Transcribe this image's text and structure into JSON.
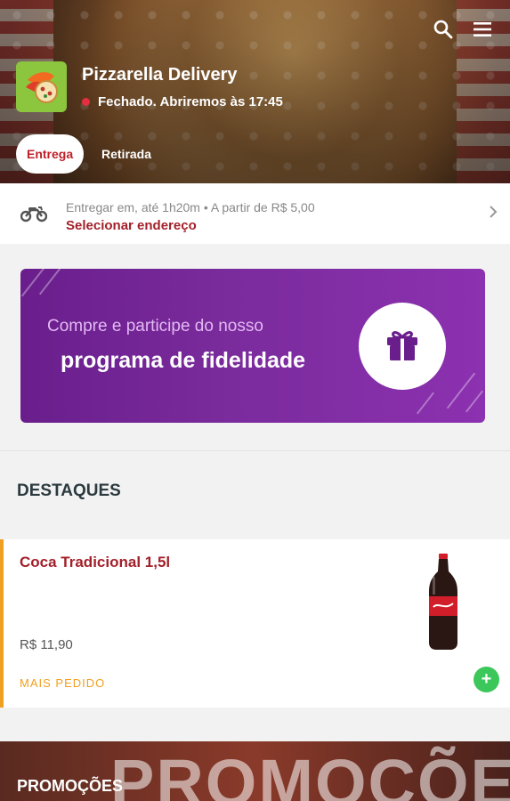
{
  "store": {
    "name": "Pizzarella Delivery",
    "status": "Fechado. Abriremos às 17:45",
    "status_color": "#e52e3f"
  },
  "header": {
    "icons": [
      "search-icon",
      "menu-icon"
    ]
  },
  "modes": {
    "active": "Entrega",
    "other": "Retirada"
  },
  "delivery": {
    "info": "Entregar em, até 1h20m  •  A partir de R$ 5,00",
    "action": "Selecionar endereço"
  },
  "banner": {
    "line1": "Compre e participe do nosso",
    "line2": "programa de fidelidade",
    "icon": "gift-icon"
  },
  "highlights": {
    "title": "DESTAQUES",
    "product": {
      "name": "Coca Tradicional 1,5l",
      "price": "R$ 11,90",
      "tag": "MAIS PEDIDO",
      "add_label": "+"
    }
  },
  "promotions": {
    "title": "PROMOÇÕES",
    "background_text": "PROMOÇÕES"
  },
  "colors": {
    "brand_red": "#a3202a",
    "accent_orange": "#f0a020",
    "banner_purple": "#7a2b9c",
    "add_green": "#3cc75a"
  }
}
